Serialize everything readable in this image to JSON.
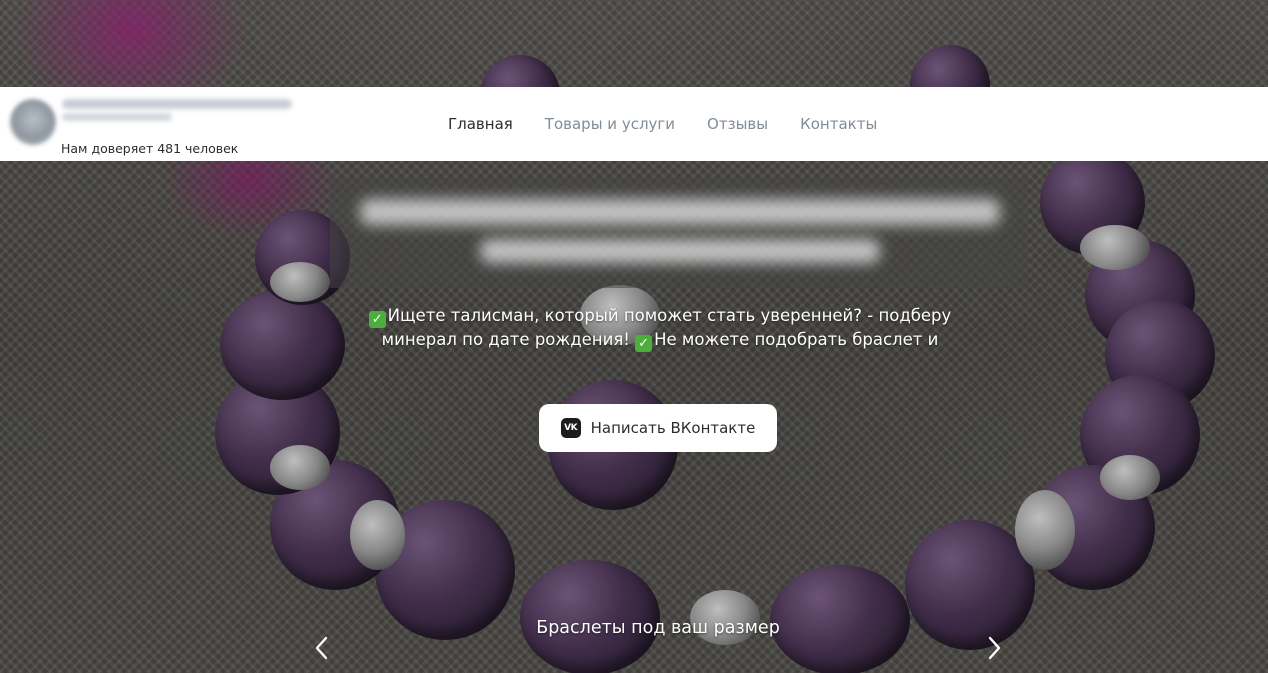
{
  "header": {
    "trust_text": "Нам доверяет 481 человек",
    "nav": [
      {
        "label": "Главная",
        "active": true
      },
      {
        "label": "Товары и услуги",
        "active": false
      },
      {
        "label": "Отзывы",
        "active": false
      },
      {
        "label": "Контакты",
        "active": false
      }
    ]
  },
  "hero": {
    "description_line1": "Ищете талисман, который поможет стать уверенней? - подберу",
    "description_line2_a": "минерал по дате рождения!",
    "description_line2_b": "Не можете подобрать браслет и",
    "cta_icon_text": "VK",
    "cta_label": "Написать ВКонтакте",
    "slide_caption": "Браслеты под ваш размер"
  },
  "icons": {
    "check": "check-mark-icon",
    "vk": "vk-logo-icon",
    "prev": "chevron-left-icon",
    "next": "chevron-right-icon"
  },
  "colors": {
    "header_bg": "#ffffff",
    "nav_active": "#2c2d2e",
    "nav_inactive": "#818c99",
    "check_green": "#4cae3b",
    "cta_bg": "#ffffff"
  }
}
